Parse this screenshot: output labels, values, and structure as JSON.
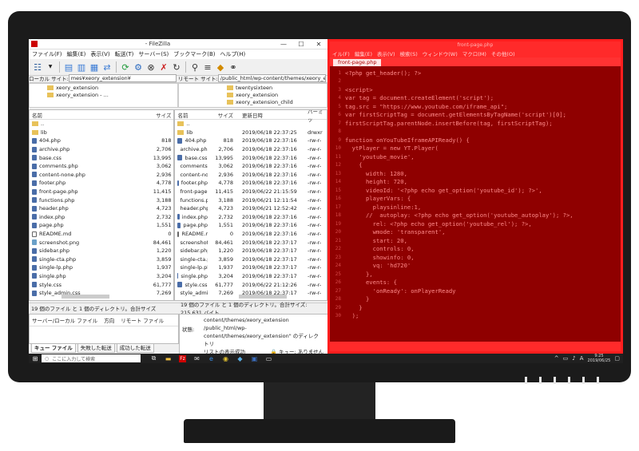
{
  "filezilla": {
    "title": "- FileZilla",
    "menu": [
      "ファイル(F)",
      "編集(E)",
      "表示(V)",
      "転送(T)",
      "サーバー(S)",
      "ブックマーク(B)",
      "ヘルプ(H)"
    ],
    "local_site_label": "ローカル サイト:",
    "local_site_path": "mes¥xeory_extension¥",
    "remote_site_label": "リモート サイト:",
    "remote_site_path": "/public_html/wp-content/themes/xeory_extension",
    "local_tree": [
      "xeory_extension",
      "xeory_extension - ..."
    ],
    "remote_tree": [
      "twentysixteen",
      "xeory_extension",
      "xeory_extension_child"
    ],
    "local_headers": {
      "name": "名前",
      "size": "サイズ"
    },
    "remote_headers": {
      "name": "名前",
      "size": "サイズ",
      "date": "更新日時",
      "perm": "パーミッ"
    },
    "local_files": [
      {
        "name": "..",
        "size": ""
      },
      {
        "name": "lib",
        "size": ""
      },
      {
        "name": "404.php",
        "size": "818"
      },
      {
        "name": "archive.php",
        "size": "2,706"
      },
      {
        "name": "base.css",
        "size": "13,995"
      },
      {
        "name": "comments.php",
        "size": "3,062"
      },
      {
        "name": "content-none.php",
        "size": "2,936"
      },
      {
        "name": "footer.php",
        "size": "4,778"
      },
      {
        "name": "front-page.php",
        "size": "11,415"
      },
      {
        "name": "functions.php",
        "size": "3,188"
      },
      {
        "name": "header.php",
        "size": "4,723"
      },
      {
        "name": "index.php",
        "size": "2,732"
      },
      {
        "name": "page.php",
        "size": "1,551"
      },
      {
        "name": "README.md",
        "size": "0"
      },
      {
        "name": "screenshot.png",
        "size": "84,461"
      },
      {
        "name": "sidebar.php",
        "size": "1,220"
      },
      {
        "name": "single-cta.php",
        "size": "3,859"
      },
      {
        "name": "single-lp.php",
        "size": "1,937"
      },
      {
        "name": "single.php",
        "size": "3,204"
      },
      {
        "name": "style.css",
        "size": "61,777"
      },
      {
        "name": "style_admin.css",
        "size": "7,269"
      }
    ],
    "remote_files": [
      {
        "name": "..",
        "size": "",
        "date": "",
        "perm": ""
      },
      {
        "name": "lib",
        "size": "",
        "date": "2019/06/18 22:37:25",
        "perm": "drwxr"
      },
      {
        "name": "404.php",
        "size": "818",
        "date": "2019/06/18 22:37:16",
        "perm": "-rw-r-"
      },
      {
        "name": "archive.php",
        "size": "2,706",
        "date": "2019/06/18 22:37:16",
        "perm": "-rw-r-"
      },
      {
        "name": "base.css",
        "size": "13,995",
        "date": "2019/06/18 22:37:16",
        "perm": "-rw-r-"
      },
      {
        "name": "comments.php",
        "size": "3,062",
        "date": "2019/06/18 22:37:16",
        "perm": "-rw-r-"
      },
      {
        "name": "content-none.php",
        "size": "2,936",
        "date": "2019/06/18 22:37:16",
        "perm": "-rw-r-"
      },
      {
        "name": "footer.php",
        "size": "4,778",
        "date": "2019/06/18 22:37:16",
        "perm": "-rw-r-"
      },
      {
        "name": "front-page.php",
        "size": "11,415",
        "date": "2019/06/22 21:15:59",
        "perm": "-rw-r-"
      },
      {
        "name": "functions.php",
        "size": "3,188",
        "date": "2019/06/21 12:11:54",
        "perm": "-rw-r-"
      },
      {
        "name": "header.php",
        "size": "4,723",
        "date": "2019/06/21 12:52:42",
        "perm": "-rw-r-"
      },
      {
        "name": "index.php",
        "size": "2,732",
        "date": "2019/06/18 22:37:16",
        "perm": "-rw-r-"
      },
      {
        "name": "page.php",
        "size": "1,551",
        "date": "2019/06/18 22:37:16",
        "perm": "-rw-r-"
      },
      {
        "name": "README.md",
        "size": "0",
        "date": "2019/06/18 22:37:16",
        "perm": "-rw-r-"
      },
      {
        "name": "screenshot.png",
        "size": "84,461",
        "date": "2019/06/18 22:37:17",
        "perm": "-rw-r-"
      },
      {
        "name": "sidebar.php",
        "size": "1,220",
        "date": "2019/06/18 22:37:17",
        "perm": "-rw-r-"
      },
      {
        "name": "single-cta.php",
        "size": "3,859",
        "date": "2019/06/18 22:37:17",
        "perm": "-rw-r-"
      },
      {
        "name": "single-lp.php",
        "size": "1,937",
        "date": "2019/06/18 22:37:17",
        "perm": "-rw-r-"
      },
      {
        "name": "single.php",
        "size": "3,204",
        "date": "2019/06/18 22:37:17",
        "perm": "-rw-r-"
      },
      {
        "name": "style.css",
        "size": "61,777",
        "date": "2019/06/22 21:12:26",
        "perm": "-rw-r-"
      },
      {
        "name": "style_admin.css",
        "size": "7,269",
        "date": "2019/06/18 22:37:17",
        "perm": "-rw-r-"
      }
    ],
    "local_status": "19 個のファイル と 1 個のディレクトリ。合計サイズ",
    "remote_status": "19 個のファイル と 1 個のディレクトリ。合計サイズ: 215,631 バイト",
    "queue_headers": [
      "サーバー/ローカル ファイル",
      "方向",
      "リモート ファイル"
    ],
    "queue_tabs": [
      "キュー ファイル",
      "失敗した転送",
      "成功した転送"
    ],
    "log_lines": [
      "content/themes/xeory_extension",
      "/public_html/wp-",
      "content/themes/xeory_extension\" のディレクトリ",
      "リストの表示成功"
    ],
    "log_label": "状態:",
    "queue_status": "キュー: ありません"
  },
  "editor": {
    "title": "front-page.php",
    "menu": [
      "イル(F)",
      "編集(E)",
      "表示(V)",
      "検索(S)",
      "ウィンドウ(W)",
      "マクロ(M)",
      "その他(O)"
    ],
    "tab": "front-page.php",
    "lines": [
      "<?php get_header(); ?>",
      "",
      "<script>",
      "var tag = document.createElement('script');",
      "tag.src = \"https://www.youtube.com/iframe_api\";",
      "var firstScriptTag = document.getElementsByTagName('script')[0];",
      "firstScriptTag.parentNode.insertBefore(tag, firstScriptTag);",
      "",
      "function onYouTubeIframeAPIReady() {",
      "  ytPlayer = new YT.Player(",
      "    'youtube_movie',",
      "    {",
      "      width: 1280,",
      "      height: 720,",
      "      videoId: '<?php echo get_option('youtube_id'); ?>',",
      "      playerVars: {",
      "        playsinline:1,",
      "      //  autoplay: <?php echo get_option('youtube_autoplay'); ?>,",
      "        rel: <?php echo get_option('youtube_rel'); ?>,",
      "        wmode: 'transparent',",
      "        start: 20,",
      "        controls: 0,",
      "        showinfo: 0,",
      "        vq: 'hd720'",
      "      },",
      "      events: {",
      "        'onReady': onPlayerReady",
      "      }",
      "    }",
      "  );"
    ]
  },
  "taskbar": {
    "search_placeholder": "ここに入力して検索",
    "time": "9:25",
    "date": "2019/06/25"
  }
}
